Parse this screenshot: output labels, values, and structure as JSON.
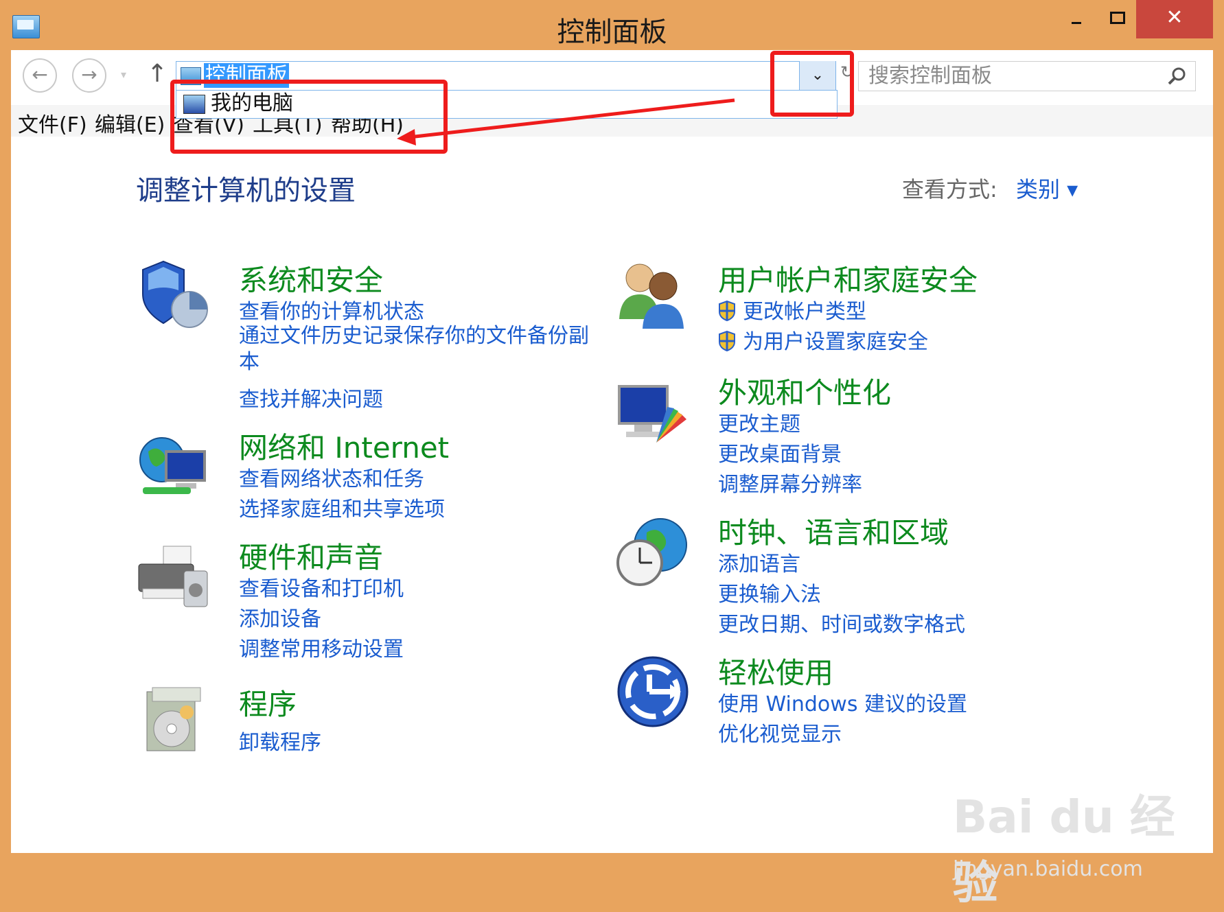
{
  "window": {
    "title": "控制面板",
    "minimize": "",
    "maximize": "",
    "close": "✕"
  },
  "nav": {
    "back": "←",
    "forward": "→",
    "up": "↑",
    "history": "▾",
    "address": "控制面板",
    "dropdown_glyph": "⌄",
    "refresh": "↻",
    "search_placeholder": "搜索控制面板"
  },
  "popup": {
    "item": "我的电脑"
  },
  "menu": [
    "文件(F)",
    "编辑(E)",
    "查看(V)",
    "工具(T)",
    "帮助(H)"
  ],
  "content": {
    "heading": "调整计算机的设置",
    "view_label": "查看方式:",
    "view_value": "类别 ▾",
    "left": [
      {
        "title": "系统和安全",
        "icon": "shield-icon",
        "links": [
          "查看你的计算机状态",
          "通过文件历史记录保存你的文件备份副本",
          "查找并解决问题"
        ]
      },
      {
        "title": "网络和 Internet",
        "icon": "network-icon",
        "links": [
          "查看网络状态和任务",
          "选择家庭组和共享选项"
        ]
      },
      {
        "title": "硬件和声音",
        "icon": "printer-icon",
        "links": [
          "查看设备和打印机",
          "添加设备",
          "调整常用移动设置"
        ]
      },
      {
        "title": "程序",
        "icon": "programs-icon",
        "links": [
          "卸载程序"
        ]
      }
    ],
    "right": [
      {
        "title": "用户帐户和家庭安全",
        "icon": "users-icon",
        "links": [
          "更改帐户类型",
          "为用户设置家庭安全"
        ]
      },
      {
        "title": "外观和个性化",
        "icon": "appearance-icon",
        "links": [
          "更改主题",
          "更改桌面背景",
          "调整屏幕分辨率"
        ]
      },
      {
        "title": "时钟、语言和区域",
        "icon": "clock-globe-icon",
        "links": [
          "添加语言",
          "更换输入法",
          "更改日期、时间或数字格式"
        ]
      },
      {
        "title": "轻松使用",
        "icon": "ease-of-access-icon",
        "links": [
          "使用 Windows 建议的设置",
          "优化视觉显示"
        ]
      }
    ]
  },
  "watermark": {
    "brand": "Bai du 经验",
    "url": "jingyan.baidu.com"
  },
  "colors": {
    "frame": "#E8A45E",
    "category_title": "#0C8A1E",
    "link": "#1A5CCF",
    "heading": "#1E3D8A",
    "annotation": "#EE1C1C",
    "close_button": "#C9473D"
  }
}
